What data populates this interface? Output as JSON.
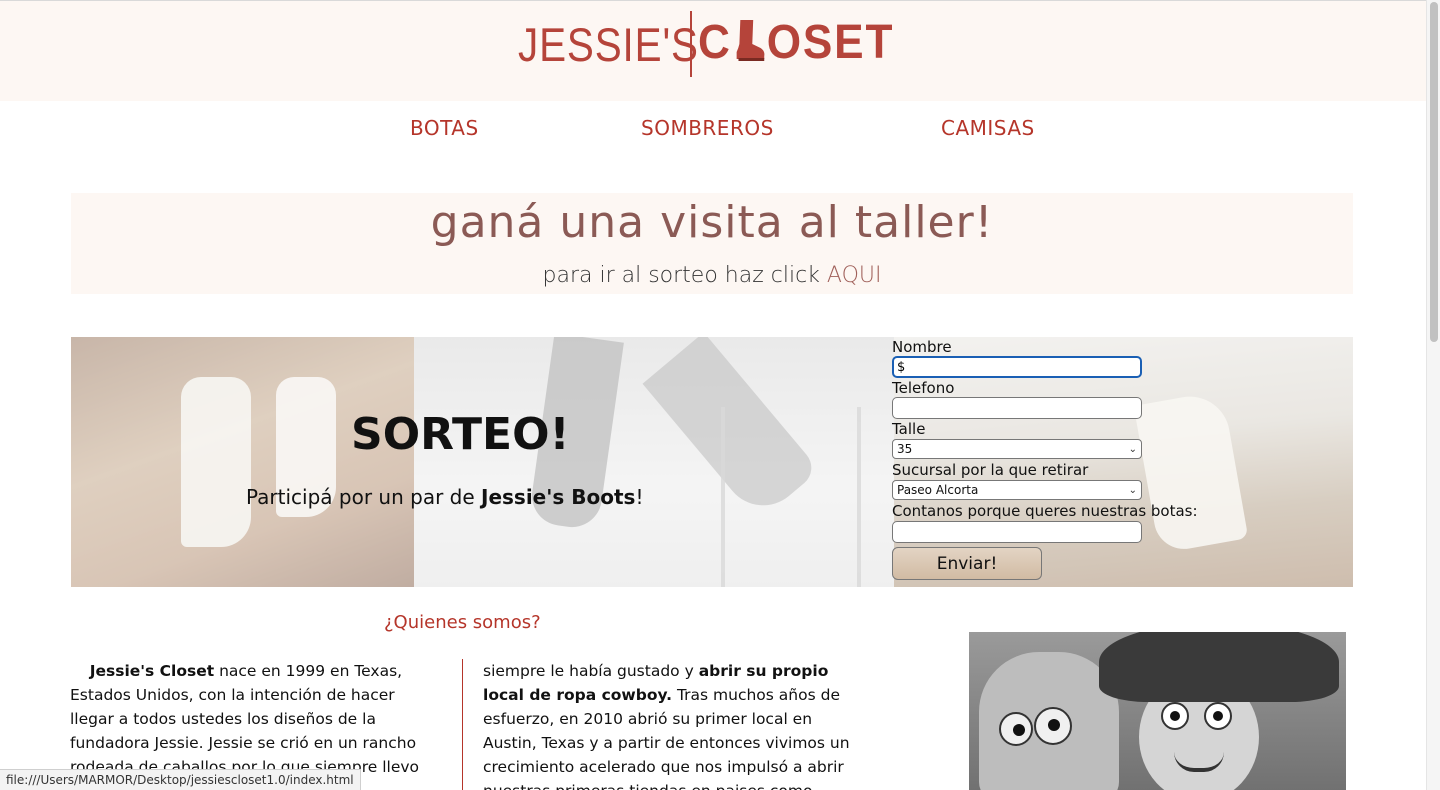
{
  "header": {
    "logo_left": "JESSIE'S",
    "logo_right_c": "C",
    "logo_right_rest": "OSET",
    "logo_boot_icon": "cowboy-boot-icon"
  },
  "nav": {
    "items": [
      {
        "label": "BOTAS"
      },
      {
        "label": "SOMBREROS"
      },
      {
        "label": "CAMISAS"
      }
    ]
  },
  "promo": {
    "title": "ganá una visita al taller!",
    "subtitle_prefix": "para ir al sorteo haz click ",
    "link_label": "AQUI"
  },
  "hero": {
    "title": "SORTEO!",
    "subtitle_prefix": "Participá por un par de ",
    "subtitle_bold": "Jessie's Boots",
    "subtitle_suffix": "!"
  },
  "form": {
    "name_label": "Nombre",
    "name_value": "$",
    "phone_label": "Telefono",
    "phone_value": "",
    "size_label": "Talle",
    "size_value": "35",
    "branch_label": "Sucursal por la que retirar",
    "branch_value": "Paseo Alcorta",
    "reason_label": "Contanos porque queres nuestras botas:",
    "reason_value": "",
    "submit_label": "Enviar!"
  },
  "about": {
    "title": "¿Quienes somos?",
    "col1_bold": "Jessie's Closet",
    "col1_text": " nace en 1999 en Texas, Estados Unidos, con la intención de hacer llegar a todos ustedes los diseños de la fundadora Jessie. Jessie se crió en un rancho rodeada de caballos por lo que siempre llevo un estilo",
    "col2_text_a": "siempre le había gustado y ",
    "col2_bold": "abrir su propio local de ropa cowboy.",
    "col2_text_b": " Tras muchos años de esfuerzo, en 2010 abrió su primer local en Austin, Texas y a partir de entonces vivimos un crecimiento acelerado que nos impulsó a abrir nuestras primeras tiendas en paises como"
  },
  "status": {
    "url": "file:///Users/MARMOR/Desktop/jessiescloset1.0/index.html"
  }
}
